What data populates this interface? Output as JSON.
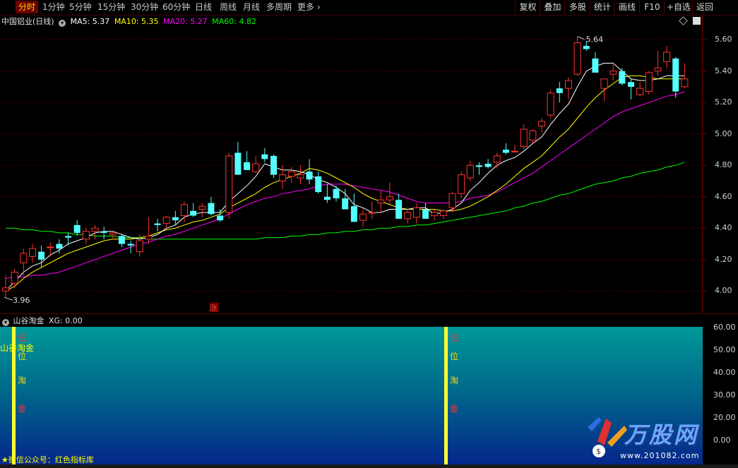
{
  "toolbar": {
    "periods": [
      "分时",
      "1分钟",
      "5分钟",
      "15分钟",
      "30分钟",
      "60分钟",
      "日线",
      "周线",
      "月线",
      "多周期",
      "更多"
    ],
    "active_index": 0,
    "right_buttons": [
      "复权",
      "叠加",
      "多股",
      "统计",
      "画线",
      "F10",
      "+自选",
      "返回"
    ]
  },
  "chart": {
    "title": "中国铝业(日线)",
    "ma": [
      {
        "label": "MA5: 5.37",
        "color": "#ffffff"
      },
      {
        "label": "MA10: 5.35",
        "color": "#ffff00"
      },
      {
        "label": "MA20: 5.27",
        "color": "#ff00ff"
      },
      {
        "label": "MA60: 4.82",
        "color": "#00ff00"
      }
    ],
    "high_label": "5.64",
    "low_label": "3.96",
    "up_marker": "涨",
    "price_labels": [
      "5.60",
      "5.40",
      "5.20",
      "5.00",
      "4.80",
      "4.60",
      "4.40",
      "4.20",
      "4.00"
    ],
    "colors": {
      "up": "#ff3232",
      "down": "#54ffff",
      "ma5": "#ffffff",
      "ma10": "#ffff00",
      "ma20": "#ff00ff",
      "ma60": "#00ff00",
      "grid": "#8a0000"
    }
  },
  "indicator": {
    "name": "山谷淘金",
    "value": "XG: 0.00",
    "signal_chars": [
      "低",
      "位",
      "淘",
      "金"
    ],
    "left_tag": "山谷淘金",
    "footer": "★微信公众号：红色指标库",
    "labels": [
      "60.00",
      "50.00",
      "40.00",
      "30.00",
      "20.00",
      "0.00"
    ]
  },
  "watermark": {
    "brand": "万股网",
    "url": "www.201082.com"
  },
  "chart_data": {
    "type": "candlestick",
    "title": "中国铝业(日线)",
    "ylim": [
      3.88,
      5.74
    ],
    "candles": [
      [
        4.0,
        4.1,
        3.96,
        4.02
      ],
      [
        4.05,
        4.14,
        4.02,
        4.12
      ],
      [
        4.18,
        4.27,
        4.1,
        4.24
      ],
      [
        4.22,
        4.3,
        4.18,
        4.27
      ],
      [
        4.25,
        4.29,
        4.15,
        4.2
      ],
      [
        4.28,
        4.31,
        4.22,
        4.28
      ],
      [
        4.3,
        4.33,
        4.24,
        4.27
      ],
      [
        4.35,
        4.37,
        4.29,
        4.34
      ],
      [
        4.42,
        4.45,
        4.35,
        4.37
      ],
      [
        4.33,
        4.4,
        4.3,
        4.38
      ],
      [
        4.38,
        4.42,
        4.33,
        4.4
      ],
      [
        4.38,
        4.41,
        4.33,
        4.37
      ],
      [
        4.36,
        4.38,
        4.33,
        4.37
      ],
      [
        4.35,
        4.36,
        4.28,
        4.3
      ],
      [
        4.3,
        4.32,
        4.24,
        4.29
      ],
      [
        4.25,
        4.36,
        4.22,
        4.32
      ],
      [
        4.33,
        4.47,
        4.3,
        4.35
      ],
      [
        4.43,
        4.46,
        4.38,
        4.42
      ],
      [
        4.43,
        4.48,
        4.4,
        4.47
      ],
      [
        4.47,
        4.51,
        4.42,
        4.45
      ],
      [
        4.48,
        4.57,
        4.44,
        4.55
      ],
      [
        4.51,
        4.56,
        4.47,
        4.48
      ],
      [
        4.52,
        4.56,
        4.47,
        4.54
      ],
      [
        4.56,
        4.6,
        4.48,
        4.49
      ],
      [
        4.48,
        4.52,
        4.44,
        4.45
      ],
      [
        4.5,
        4.88,
        4.46,
        4.86
      ],
      [
        4.88,
        4.95,
        4.84,
        4.74
      ],
      [
        4.82,
        4.89,
        4.79,
        4.77
      ],
      [
        4.76,
        4.86,
        4.75,
        4.81
      ],
      [
        4.87,
        4.91,
        4.82,
        4.84
      ],
      [
        4.86,
        4.87,
        4.72,
        4.74
      ],
      [
        4.7,
        4.8,
        4.65,
        4.74
      ],
      [
        4.73,
        4.79,
        4.69,
        4.76
      ],
      [
        4.72,
        4.8,
        4.68,
        4.74
      ],
      [
        4.76,
        4.84,
        4.68,
        4.71
      ],
      [
        4.73,
        4.76,
        4.62,
        4.63
      ],
      [
        4.6,
        4.68,
        4.56,
        4.58
      ],
      [
        4.65,
        4.67,
        4.57,
        4.59
      ],
      [
        4.59,
        4.65,
        4.53,
        4.52
      ],
      [
        4.54,
        4.62,
        4.48,
        4.44
      ],
      [
        4.45,
        4.53,
        4.41,
        4.49
      ],
      [
        4.5,
        4.57,
        4.46,
        4.5
      ],
      [
        4.56,
        4.64,
        4.5,
        4.58
      ],
      [
        4.58,
        4.69,
        4.55,
        4.6
      ],
      [
        4.58,
        4.62,
        4.48,
        4.46
      ],
      [
        4.46,
        4.52,
        4.43,
        4.5
      ],
      [
        4.47,
        4.56,
        4.43,
        4.53
      ],
      [
        4.52,
        4.56,
        4.49,
        4.46
      ],
      [
        4.48,
        4.52,
        4.45,
        4.5
      ],
      [
        4.48,
        4.52,
        4.46,
        4.51
      ],
      [
        4.53,
        4.63,
        4.5,
        4.62
      ],
      [
        4.62,
        4.76,
        4.59,
        4.74
      ],
      [
        4.72,
        4.83,
        4.7,
        4.8
      ],
      [
        4.8,
        4.82,
        4.74,
        4.79
      ],
      [
        4.81,
        4.84,
        4.78,
        4.79
      ],
      [
        4.82,
        4.88,
        4.78,
        4.86
      ],
      [
        4.9,
        4.94,
        4.87,
        4.88
      ],
      [
        4.89,
        4.93,
        4.88,
        4.89
      ],
      [
        4.92,
        5.06,
        4.9,
        5.03
      ],
      [
        4.96,
        5.03,
        4.94,
        5.02
      ],
      [
        5.05,
        5.1,
        5.01,
        5.08
      ],
      [
        5.12,
        5.28,
        5.1,
        5.26
      ],
      [
        5.29,
        5.33,
        5.2,
        5.26
      ],
      [
        5.29,
        5.36,
        5.22,
        5.34
      ],
      [
        5.38,
        5.62,
        5.37,
        5.58
      ],
      [
        5.56,
        5.59,
        5.53,
        5.54
      ],
      [
        5.48,
        5.52,
        5.4,
        5.39
      ],
      [
        5.29,
        5.34,
        5.21,
        5.35
      ],
      [
        5.38,
        5.44,
        5.34,
        5.4
      ],
      [
        5.4,
        5.42,
        5.31,
        5.32
      ],
      [
        5.33,
        5.35,
        5.22,
        5.3
      ],
      [
        5.25,
        5.33,
        5.24,
        5.29
      ],
      [
        5.27,
        5.4,
        5.25,
        5.39
      ],
      [
        5.4,
        5.53,
        5.37,
        5.42
      ],
      [
        5.46,
        5.56,
        5.42,
        5.52
      ],
      [
        5.48,
        5.49,
        5.23,
        5.27
      ],
      [
        5.3,
        5.45,
        5.29,
        5.35
      ]
    ],
    "ma5": [
      4.0,
      4.06,
      4.12,
      4.16,
      4.18,
      4.23,
      4.26,
      4.3,
      4.32,
      4.34,
      4.37,
      4.38,
      4.38,
      4.36,
      4.34,
      4.33,
      4.34,
      4.36,
      4.4,
      4.42,
      4.47,
      4.49,
      4.5,
      4.5,
      4.5,
      4.57,
      4.62,
      4.67,
      4.73,
      4.81,
      4.79,
      4.77,
      4.77,
      4.76,
      4.74,
      4.71,
      4.69,
      4.66,
      4.62,
      4.55,
      4.53,
      4.5,
      4.5,
      4.52,
      4.52,
      4.52,
      4.53,
      4.53,
      4.49,
      4.5,
      4.52,
      4.56,
      4.64,
      4.69,
      4.75,
      4.8,
      4.83,
      4.85,
      4.89,
      4.94,
      4.98,
      5.06,
      5.13,
      5.19,
      5.3,
      5.4,
      5.43,
      5.45,
      5.45,
      5.4,
      5.35,
      5.34,
      5.34,
      5.35,
      5.37,
      5.37,
      5.37
    ],
    "ma10": [
      4.0,
      4.03,
      4.08,
      4.12,
      4.15,
      4.18,
      4.21,
      4.24,
      4.26,
      4.28,
      4.3,
      4.32,
      4.33,
      4.33,
      4.33,
      4.34,
      4.35,
      4.37,
      4.39,
      4.4,
      4.42,
      4.44,
      4.45,
      4.47,
      4.49,
      4.53,
      4.56,
      4.59,
      4.62,
      4.66,
      4.69,
      4.71,
      4.73,
      4.75,
      4.78,
      4.77,
      4.75,
      4.72,
      4.69,
      4.66,
      4.62,
      4.59,
      4.57,
      4.55,
      4.53,
      4.52,
      4.52,
      4.52,
      4.52,
      4.51,
      4.51,
      4.52,
      4.54,
      4.57,
      4.6,
      4.64,
      4.68,
      4.73,
      4.78,
      4.82,
      4.86,
      4.92,
      4.98,
      5.03,
      5.1,
      5.17,
      5.23,
      5.28,
      5.32,
      5.36,
      5.37,
      5.37,
      5.36,
      5.35,
      5.35,
      5.35,
      5.35
    ],
    "ma20": [
      4.08,
      4.09,
      4.09,
      4.1,
      4.1,
      4.11,
      4.12,
      4.14,
      4.16,
      4.18,
      4.2,
      4.22,
      4.24,
      4.26,
      4.28,
      4.3,
      4.31,
      4.33,
      4.35,
      4.36,
      4.38,
      4.4,
      4.42,
      4.44,
      4.46,
      4.49,
      4.52,
      4.55,
      4.57,
      4.59,
      4.6,
      4.62,
      4.63,
      4.64,
      4.65,
      4.67,
      4.68,
      4.68,
      4.68,
      4.67,
      4.66,
      4.65,
      4.64,
      4.63,
      4.61,
      4.59,
      4.57,
      4.56,
      4.56,
      4.56,
      4.56,
      4.57,
      4.59,
      4.6,
      4.61,
      4.63,
      4.66,
      4.69,
      4.72,
      4.75,
      4.79,
      4.83,
      4.87,
      4.91,
      4.95,
      4.99,
      5.03,
      5.07,
      5.11,
      5.14,
      5.16,
      5.18,
      5.2,
      5.22,
      5.24,
      5.25,
      5.27
    ],
    "ma60": [
      4.4,
      4.4,
      4.39,
      4.39,
      4.38,
      4.38,
      4.37,
      4.37,
      4.36,
      4.36,
      4.35,
      4.35,
      4.35,
      4.34,
      4.34,
      4.34,
      4.33,
      4.33,
      4.33,
      4.33,
      4.33,
      4.33,
      4.33,
      4.33,
      4.33,
      4.33,
      4.33,
      4.33,
      4.33,
      4.34,
      4.34,
      4.34,
      4.35,
      4.35,
      4.36,
      4.36,
      4.37,
      4.37,
      4.38,
      4.38,
      4.39,
      4.39,
      4.4,
      4.4,
      4.41,
      4.41,
      4.42,
      4.42,
      4.43,
      4.44,
      4.45,
      4.46,
      4.47,
      4.48,
      4.49,
      4.5,
      4.51,
      4.53,
      4.54,
      4.56,
      4.57,
      4.59,
      4.61,
      4.62,
      4.64,
      4.66,
      4.68,
      4.69,
      4.7,
      4.72,
      4.73,
      4.75,
      4.76,
      4.77,
      4.79,
      4.8,
      4.82
    ],
    "signal_positions": [
      1,
      51
    ]
  }
}
